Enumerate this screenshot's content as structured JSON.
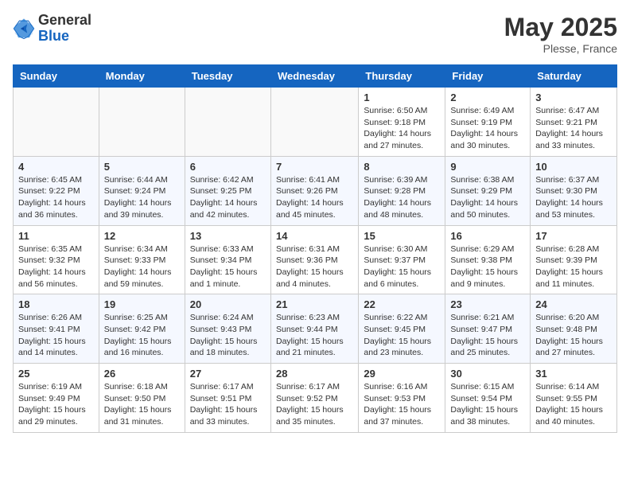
{
  "header": {
    "logo_general": "General",
    "logo_blue": "Blue",
    "month_year": "May 2025",
    "location": "Plesse, France"
  },
  "days_of_week": [
    "Sunday",
    "Monday",
    "Tuesday",
    "Wednesday",
    "Thursday",
    "Friday",
    "Saturday"
  ],
  "weeks": [
    [
      {
        "day": "",
        "info": ""
      },
      {
        "day": "",
        "info": ""
      },
      {
        "day": "",
        "info": ""
      },
      {
        "day": "",
        "info": ""
      },
      {
        "day": "1",
        "info": "Sunrise: 6:50 AM\nSunset: 9:18 PM\nDaylight: 14 hours and 27 minutes."
      },
      {
        "day": "2",
        "info": "Sunrise: 6:49 AM\nSunset: 9:19 PM\nDaylight: 14 hours and 30 minutes."
      },
      {
        "day": "3",
        "info": "Sunrise: 6:47 AM\nSunset: 9:21 PM\nDaylight: 14 hours and 33 minutes."
      }
    ],
    [
      {
        "day": "4",
        "info": "Sunrise: 6:45 AM\nSunset: 9:22 PM\nDaylight: 14 hours and 36 minutes."
      },
      {
        "day": "5",
        "info": "Sunrise: 6:44 AM\nSunset: 9:24 PM\nDaylight: 14 hours and 39 minutes."
      },
      {
        "day": "6",
        "info": "Sunrise: 6:42 AM\nSunset: 9:25 PM\nDaylight: 14 hours and 42 minutes."
      },
      {
        "day": "7",
        "info": "Sunrise: 6:41 AM\nSunset: 9:26 PM\nDaylight: 14 hours and 45 minutes."
      },
      {
        "day": "8",
        "info": "Sunrise: 6:39 AM\nSunset: 9:28 PM\nDaylight: 14 hours and 48 minutes."
      },
      {
        "day": "9",
        "info": "Sunrise: 6:38 AM\nSunset: 9:29 PM\nDaylight: 14 hours and 50 minutes."
      },
      {
        "day": "10",
        "info": "Sunrise: 6:37 AM\nSunset: 9:30 PM\nDaylight: 14 hours and 53 minutes."
      }
    ],
    [
      {
        "day": "11",
        "info": "Sunrise: 6:35 AM\nSunset: 9:32 PM\nDaylight: 14 hours and 56 minutes."
      },
      {
        "day": "12",
        "info": "Sunrise: 6:34 AM\nSunset: 9:33 PM\nDaylight: 14 hours and 59 minutes."
      },
      {
        "day": "13",
        "info": "Sunrise: 6:33 AM\nSunset: 9:34 PM\nDaylight: 15 hours and 1 minute."
      },
      {
        "day": "14",
        "info": "Sunrise: 6:31 AM\nSunset: 9:36 PM\nDaylight: 15 hours and 4 minutes."
      },
      {
        "day": "15",
        "info": "Sunrise: 6:30 AM\nSunset: 9:37 PM\nDaylight: 15 hours and 6 minutes."
      },
      {
        "day": "16",
        "info": "Sunrise: 6:29 AM\nSunset: 9:38 PM\nDaylight: 15 hours and 9 minutes."
      },
      {
        "day": "17",
        "info": "Sunrise: 6:28 AM\nSunset: 9:39 PM\nDaylight: 15 hours and 11 minutes."
      }
    ],
    [
      {
        "day": "18",
        "info": "Sunrise: 6:26 AM\nSunset: 9:41 PM\nDaylight: 15 hours and 14 minutes."
      },
      {
        "day": "19",
        "info": "Sunrise: 6:25 AM\nSunset: 9:42 PM\nDaylight: 15 hours and 16 minutes."
      },
      {
        "day": "20",
        "info": "Sunrise: 6:24 AM\nSunset: 9:43 PM\nDaylight: 15 hours and 18 minutes."
      },
      {
        "day": "21",
        "info": "Sunrise: 6:23 AM\nSunset: 9:44 PM\nDaylight: 15 hours and 21 minutes."
      },
      {
        "day": "22",
        "info": "Sunrise: 6:22 AM\nSunset: 9:45 PM\nDaylight: 15 hours and 23 minutes."
      },
      {
        "day": "23",
        "info": "Sunrise: 6:21 AM\nSunset: 9:47 PM\nDaylight: 15 hours and 25 minutes."
      },
      {
        "day": "24",
        "info": "Sunrise: 6:20 AM\nSunset: 9:48 PM\nDaylight: 15 hours and 27 minutes."
      }
    ],
    [
      {
        "day": "25",
        "info": "Sunrise: 6:19 AM\nSunset: 9:49 PM\nDaylight: 15 hours and 29 minutes."
      },
      {
        "day": "26",
        "info": "Sunrise: 6:18 AM\nSunset: 9:50 PM\nDaylight: 15 hours and 31 minutes."
      },
      {
        "day": "27",
        "info": "Sunrise: 6:17 AM\nSunset: 9:51 PM\nDaylight: 15 hours and 33 minutes."
      },
      {
        "day": "28",
        "info": "Sunrise: 6:17 AM\nSunset: 9:52 PM\nDaylight: 15 hours and 35 minutes."
      },
      {
        "day": "29",
        "info": "Sunrise: 6:16 AM\nSunset: 9:53 PM\nDaylight: 15 hours and 37 minutes."
      },
      {
        "day": "30",
        "info": "Sunrise: 6:15 AM\nSunset: 9:54 PM\nDaylight: 15 hours and 38 minutes."
      },
      {
        "day": "31",
        "info": "Sunrise: 6:14 AM\nSunset: 9:55 PM\nDaylight: 15 hours and 40 minutes."
      }
    ]
  ]
}
